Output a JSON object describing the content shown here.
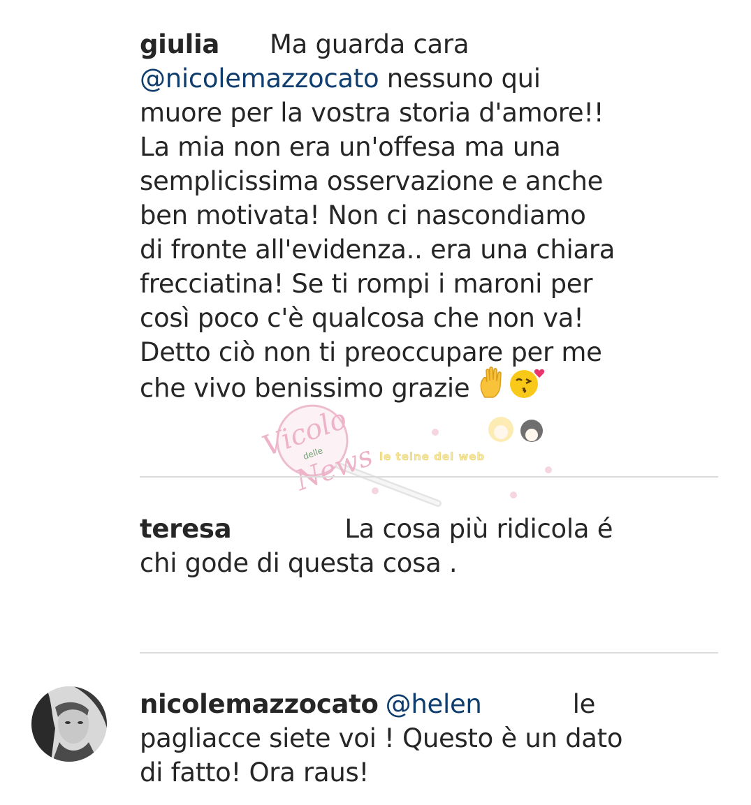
{
  "comments": [
    {
      "username": "giulia",
      "lines": [
        {
          "pre": "",
          "text": "Ma guarda cara"
        },
        {
          "mention": "@nicolemazzocato",
          "text": " nessuno qui"
        },
        {
          "text": "muore per la vostra storia d'amore!!"
        },
        {
          "text": "La mia non era un'offesa ma una"
        },
        {
          "text": "semplicissima osservazione e anche"
        },
        {
          "text": "ben motivata! Non ci nascondiamo"
        },
        {
          "text": "di fronte all'evidenza.. era una chiara"
        },
        {
          "text": "frecciatina! Se ti rompi i maroni per"
        },
        {
          "text": "così poco c'è qualcosa che non va!"
        },
        {
          "text": "Detto ciò non ti preoccupare per me"
        },
        {
          "text": "che vivo benissimo grazie "
        }
      ],
      "emojis": [
        "raised-hand-emoji",
        "kissing-face-emoji"
      ]
    },
    {
      "username": "teresa",
      "lines": [
        {
          "text": "La cosa più ridicola é"
        },
        {
          "text": "chi gode di questa cosa ."
        }
      ]
    },
    {
      "username": "nicolemazzocato",
      "mention": "@helen",
      "lines": [
        {
          "text": "le"
        },
        {
          "text": "pagliacce siete voi ! Questo è un dato"
        },
        {
          "text": "di fatto! Ora raus!"
        }
      ]
    }
  ],
  "watermark": {
    "brand_script": "Vicolo",
    "brand_small": "delle",
    "brand_script2": "News",
    "tagline": "le teine del web"
  },
  "colors": {
    "mention": "#0f3d6e",
    "divider": "#dbdbdb",
    "text": "#262626"
  }
}
